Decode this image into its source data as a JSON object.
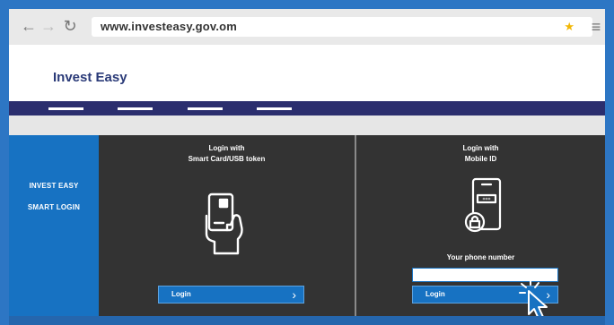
{
  "browser": {
    "back_icon": "back-arrow-icon",
    "forward_icon": "forward-arrow-icon",
    "reload_icon": "reload-icon",
    "url": "www.investeasy.gov.om",
    "bookmark_icon": "star-icon",
    "menu_icon": "hamburger-menu-icon"
  },
  "header": {
    "title": "Invest Easy"
  },
  "sidebar": {
    "line1": "INVEST EASY",
    "line2": "SMART LOGIN"
  },
  "smart_card": {
    "title_line1": "Login with",
    "title_line2": "Smart Card/USB token",
    "icon": "smart-card-icon",
    "button_label": "Login"
  },
  "mobile_id": {
    "title_line1": "Login with",
    "title_line2": "Mobile ID",
    "icon": "mobile-phone-lock-icon",
    "phone_label": "Your phone number",
    "phone_value": "",
    "button_label": "Login"
  },
  "colors": {
    "background": "#2d76c4",
    "brand_blue": "#1772c2",
    "navbar": "#2b2e6e",
    "panel": "#333333",
    "title": "#2a3a78"
  }
}
